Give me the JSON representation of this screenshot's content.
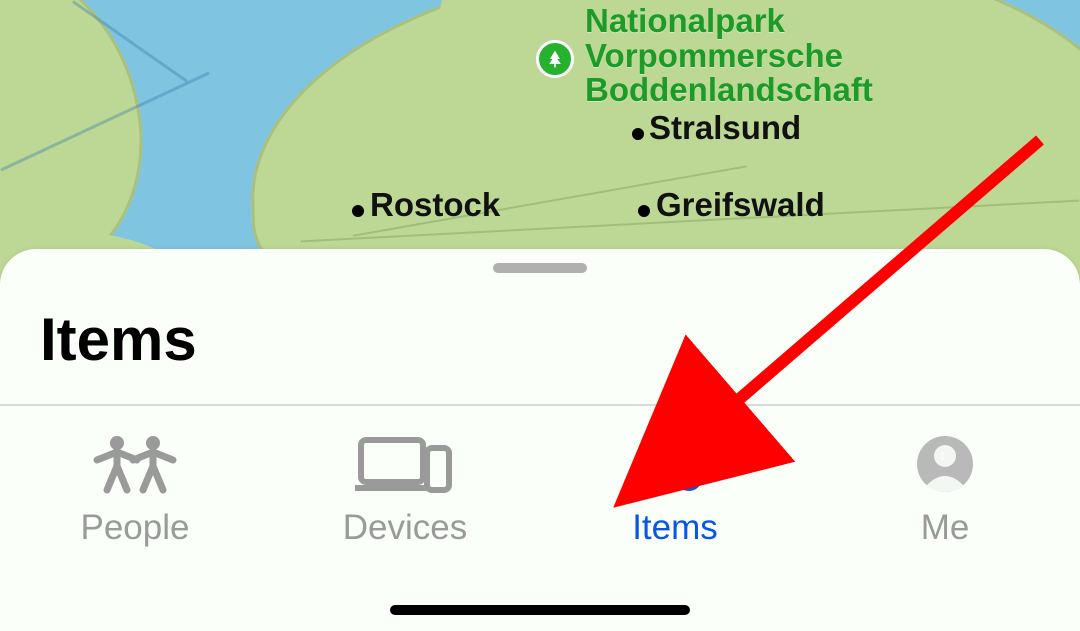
{
  "map": {
    "park_label_line1": "Nationalpark",
    "park_label_line2": "Vorpommersche",
    "park_label_line3": "Boddenlandschaft",
    "cities": {
      "rostock": "Rostock",
      "stralsund": "Stralsund",
      "greifswald": "Greifswald"
    }
  },
  "sheet": {
    "title": "Items"
  },
  "tabs": {
    "people": "People",
    "devices": "Devices",
    "items": "Items",
    "me": "Me"
  },
  "colors": {
    "accent": "#0955E6",
    "inactive": "#9A9A9A",
    "annotation_arrow": "#FF0000"
  }
}
